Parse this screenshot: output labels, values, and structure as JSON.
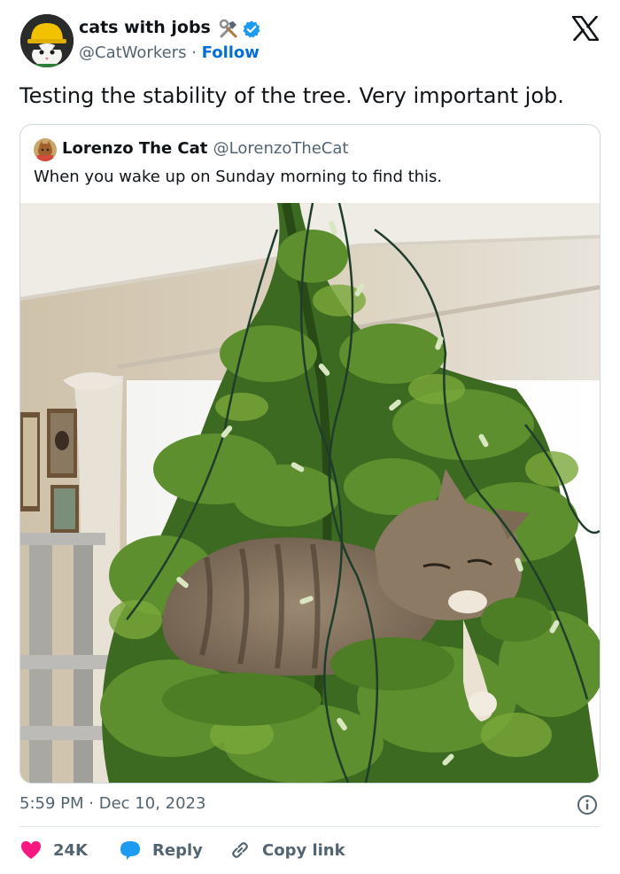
{
  "header": {
    "author_name": "cats with jobs",
    "author_badge_icon": "hammer-wrench-icon",
    "verified_icon": "verified-badge-icon",
    "handle": "@CatWorkers",
    "separator": "·",
    "follow_label": "Follow",
    "logo_icon": "x-logo-icon"
  },
  "tweet": {
    "text": "Testing the stability of the tree. Very important job."
  },
  "quote": {
    "author_name": "Lorenzo The Cat",
    "handle": "@LorenzoTheCat",
    "text": "When you wake up on Sunday morning to find this."
  },
  "meta": {
    "time": "5:59 PM",
    "separator": "·",
    "date": "Dec 10, 2023",
    "info_icon": "info-icon"
  },
  "actions": {
    "like_count": "24K",
    "reply_label": "Reply",
    "copy_label": "Copy link"
  },
  "colors": {
    "link": "#006fd6",
    "verified": "#1d9bf0",
    "like": "#f91880",
    "muted": "#536471",
    "border": "#cfd9de"
  }
}
